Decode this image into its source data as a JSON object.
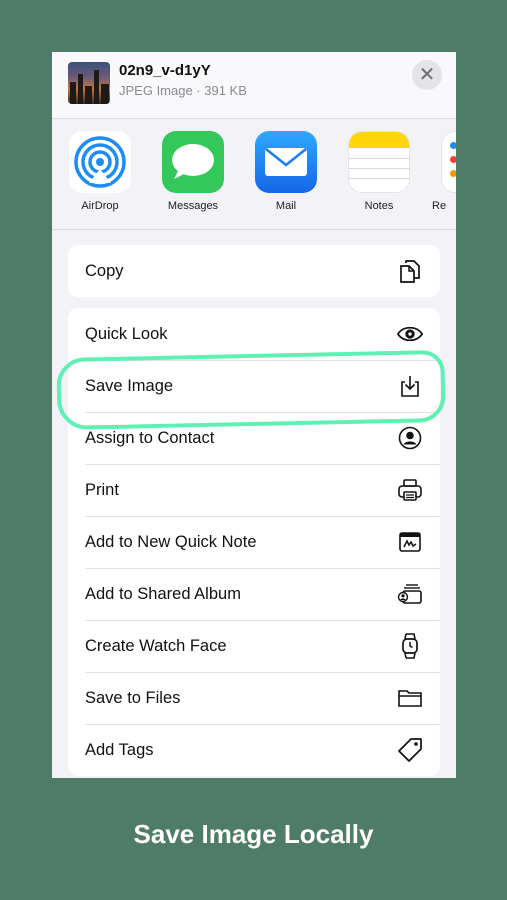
{
  "header": {
    "file_name": "02n9_v-d1yY",
    "file_meta": "JPEG Image · 391 KB",
    "close_label": "✕"
  },
  "apps": [
    {
      "label": "AirDrop",
      "icon": "airdrop-icon"
    },
    {
      "label": "Messages",
      "icon": "messages-icon"
    },
    {
      "label": "Mail",
      "icon": "mail-icon"
    },
    {
      "label": "Notes",
      "icon": "notes-icon"
    },
    {
      "label": "Re",
      "icon": "reminders-icon"
    }
  ],
  "actions_top": [
    {
      "label": "Copy",
      "icon": "copy-icon"
    }
  ],
  "actions": [
    {
      "label": "Quick Look",
      "icon": "eye-icon"
    },
    {
      "label": "Save Image",
      "icon": "save-image-icon"
    },
    {
      "label": "Assign to Contact",
      "icon": "contact-icon"
    },
    {
      "label": "Print",
      "icon": "printer-icon"
    },
    {
      "label": "Add to New Quick Note",
      "icon": "quick-note-icon"
    },
    {
      "label": "Add to Shared Album",
      "icon": "shared-album-icon"
    },
    {
      "label": "Create Watch Face",
      "icon": "watch-icon"
    },
    {
      "label": "Save to Files",
      "icon": "folder-icon"
    },
    {
      "label": "Add Tags",
      "icon": "tag-icon"
    }
  ],
  "caption": "Save Image Locally",
  "colors": {
    "background": "#4f7b69",
    "highlight": "#5ff0b4",
    "messages_green": "#34c759",
    "mail_blue": "#1e8cf5",
    "notes_yellow": "#ffd60a"
  }
}
